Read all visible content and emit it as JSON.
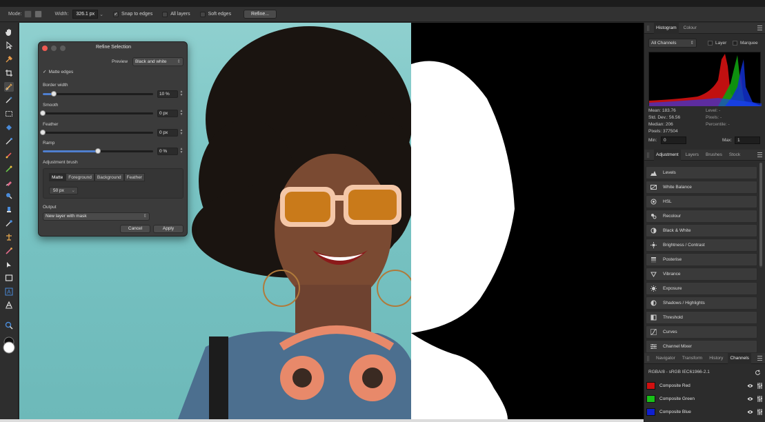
{
  "context_toolbar": {
    "mode_label": "Mode:",
    "width_label": "Width:",
    "width_value": "326.1 px",
    "snap_to_edges": {
      "label": "Snap to edges",
      "checked": true
    },
    "all_layers": {
      "label": "All layers",
      "checked": false
    },
    "soft_edges": {
      "label": "Soft edges",
      "checked": false
    },
    "refine_label": "Refine..."
  },
  "tools": [
    "hand-icon",
    "move-icon",
    "eyedropper-icon",
    "crop-icon",
    "selection-brush-icon",
    "magic-wand-icon",
    "marquee-icon",
    "fill-icon",
    "paint-brush-icon",
    "pixel-brush-icon",
    "eraser-icon",
    "dodge-icon",
    "clone-icon",
    "blur-icon",
    "sponge-icon",
    "red-eye-icon",
    "node-icon",
    "rectangle-icon",
    "text-icon",
    "frame-text-icon",
    "zoom-icon",
    "color-swatch-icon"
  ],
  "refine_dialog": {
    "title": "Refine Selection",
    "preview_label": "Preview",
    "preview_value": "Black and white",
    "matte_edges": {
      "label": "Matte edges",
      "checked": true
    },
    "sliders": [
      {
        "label": "Border width",
        "value": "10 %",
        "fraction": 0.1
      },
      {
        "label": "Smooth",
        "value": "0 px",
        "fraction": 0.0
      },
      {
        "label": "Feather",
        "value": "0 px",
        "fraction": 0.0
      },
      {
        "label": "Ramp",
        "value": "0 %",
        "fraction": 0.5
      }
    ],
    "adjustment_brush_label": "Adjustment brush",
    "brush_tabs": [
      "Matte",
      "Foreground",
      "Background",
      "Feather"
    ],
    "brush_active_tab": "Matte",
    "brush_size": "50 px",
    "output_label": "Output",
    "output_value": "New layer with mask",
    "cancel_label": "Cancel",
    "apply_label": "Apply"
  },
  "histogram_panel": {
    "tabs": [
      "Histogram",
      "Colour"
    ],
    "active_tab": "Histogram",
    "channel_select": "All Channels",
    "layer_label": "Layer",
    "marquee_label": "Marquee",
    "stats_left": [
      "Mean: 183.76",
      "Std. Dev.: 56.56",
      "Median: 206",
      "Pixels: 377504"
    ],
    "stats_right": [
      "Level: -",
      "Pixels: -",
      "Percentile: -"
    ],
    "min_label": "Min:",
    "min_value": "0",
    "max_label": "Max:",
    "max_value": "1"
  },
  "adjustment_panel": {
    "tabs": [
      "Adjustment",
      "Layers",
      "Brushes",
      "Stock"
    ],
    "active_tab": "Adjustment",
    "items": [
      {
        "label": "Levels",
        "icon": "levels-icon"
      },
      {
        "label": "White Balance",
        "icon": "white-balance-icon"
      },
      {
        "label": "HSL",
        "icon": "hsl-icon"
      },
      {
        "label": "Recolour",
        "icon": "recolour-icon"
      },
      {
        "label": "Black & White",
        "icon": "black-white-icon"
      },
      {
        "label": "Brightness / Contrast",
        "icon": "brightness-icon"
      },
      {
        "label": "Posterise",
        "icon": "posterise-icon"
      },
      {
        "label": "Vibrance",
        "icon": "vibrance-icon"
      },
      {
        "label": "Exposure",
        "icon": "exposure-icon"
      },
      {
        "label": "Shadows / Highlights",
        "icon": "shadows-highlights-icon"
      },
      {
        "label": "Threshold",
        "icon": "threshold-icon"
      },
      {
        "label": "Curves",
        "icon": "curves-icon"
      },
      {
        "label": "Channel Mixer",
        "icon": "channel-mixer-icon"
      }
    ]
  },
  "channels_panel": {
    "tabs": [
      "Navigator",
      "Transform",
      "History",
      "Channels"
    ],
    "active_tab": "Channels",
    "header": "RGBA/8 - sRGB IEC61966-2.1",
    "rows": [
      {
        "label": "Composite Red",
        "color": "#d01010"
      },
      {
        "label": "Composite Green",
        "color": "#18c018"
      },
      {
        "label": "Composite Blue",
        "color": "#1020d0"
      }
    ]
  }
}
